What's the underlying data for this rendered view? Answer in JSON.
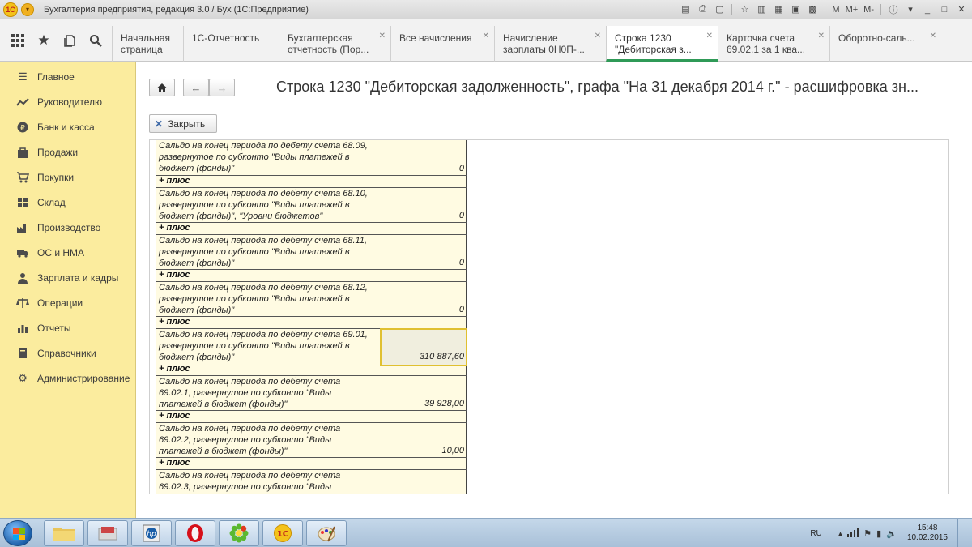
{
  "window": {
    "title": "Бухгалтерия предприятия, редакция 3.0 / Бух  (1С:Предприятие)",
    "logo_text": "1С",
    "controls": {
      "m": "M",
      "mplus": "M+",
      "mminus": "M-"
    }
  },
  "tabs": [
    {
      "label": "Начальная страница",
      "closable": false
    },
    {
      "label": "1С-Отчетность",
      "closable": false
    },
    {
      "label": "Бухгалтерская отчетность (Пор...",
      "closable": true
    },
    {
      "label": "Все начисления",
      "closable": true
    },
    {
      "label": "Начисление зарплаты 0Н0П-...",
      "closable": true
    },
    {
      "label": "Строка 1230 \"Дебиторская з...",
      "closable": true,
      "active": true
    },
    {
      "label": "Карточка счета 69.02.1 за 1 ква...",
      "closable": true
    },
    {
      "label": "Оборотно-саль...",
      "closable": true
    }
  ],
  "sidebar": {
    "items": [
      {
        "label": "Главное",
        "icon": "menu-lines-icon"
      },
      {
        "label": "Руководителю",
        "icon": "trend-icon"
      },
      {
        "label": "Банк и касса",
        "icon": "coin-icon"
      },
      {
        "label": "Продажи",
        "icon": "bag-icon"
      },
      {
        "label": "Покупки",
        "icon": "cart-icon"
      },
      {
        "label": "Склад",
        "icon": "warehouse-icon"
      },
      {
        "label": "Производство",
        "icon": "factory-icon"
      },
      {
        "label": "ОС и НМА",
        "icon": "truck-icon"
      },
      {
        "label": "Зарплата и кадры",
        "icon": "person-icon"
      },
      {
        "label": "Операции",
        "icon": "scales-icon"
      },
      {
        "label": "Отчеты",
        "icon": "bar-chart-icon"
      },
      {
        "label": "Справочники",
        "icon": "book-icon"
      },
      {
        "label": "Администрирование",
        "icon": "gear-icon"
      }
    ]
  },
  "page": {
    "title": "Строка 1230 \"Дебиторская задолженность\", графа \"На 31 декабря 2014 г.\" - расшифровка зн...",
    "close_label": "Закрыть"
  },
  "report": {
    "plus_label": "+ плюс",
    "rows": [
      {
        "text": "Сальдо на конец периода по дебету счета 68.09, развернутое по субконто \"Виды платежей в бюджет (фонды)\"",
        "value": "0"
      },
      {
        "text": "Сальдо на конец периода по дебету счета 68.10, развернутое по субконто \"Виды платежей в бюджет (фонды)\", \"Уровни бюджетов\"",
        "value": "0"
      },
      {
        "text": "Сальдо на конец периода по дебету счета 68.11, развернутое по субконто \"Виды платежей в бюджет (фонды)\"",
        "value": "0"
      },
      {
        "text": "Сальдо на конец периода по дебету счета 68.12, развернутое по субконто \"Виды платежей в бюджет (фонды)\"",
        "value": "0"
      },
      {
        "text": "Сальдо на конец периода по дебету счета 69.01, развернутое по субконто \"Виды платежей в бюджет (фонды)\"",
        "value": "310 887,60",
        "selected": true
      },
      {
        "text": "Сальдо на конец периода по дебету счета 69.02.1, развернутое по субконто \"Виды платежей в бюджет (фонды)\"",
        "value": "39 928,00"
      },
      {
        "text": "Сальдо на конец периода по дебету счета 69.02.2, развернутое по субконто \"Виды платежей в бюджет (фонды)\"",
        "value": "10,00"
      },
      {
        "text": "Сальдо на конец периода по дебету счета 69.02.3, развернутое по субконто \"Виды",
        "value": ""
      }
    ]
  },
  "taskbar": {
    "apps": [
      "explorer-folder-icon",
      "pdf-reader-icon",
      "hp-icon",
      "opera-icon",
      "icq-icon",
      "1c-icon",
      "paint-icon"
    ],
    "language": "RU",
    "time": "15:48",
    "date": "10.02.2015"
  }
}
